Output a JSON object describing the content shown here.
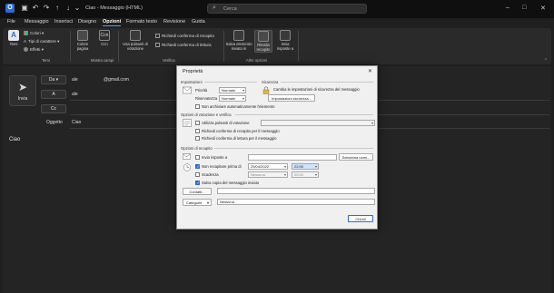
{
  "window": {
    "title": "Ciao - Messaggio (HTML)",
    "search_placeholder": "Cerca",
    "controls": {
      "minimize": "–",
      "maximize": "□",
      "close": "✕"
    },
    "quick_icons": [
      "save-icon",
      "undo-icon",
      "redo-icon",
      "up-icon",
      "down-icon",
      "customize-icon"
    ]
  },
  "menu": {
    "items": [
      "File",
      "Messaggio",
      "Inserisci",
      "Disegno",
      "Opzioni",
      "Formato testo",
      "Revisione",
      "Guida"
    ],
    "active": "Opzioni"
  },
  "ribbon": {
    "temi": {
      "big": "Temi",
      "colors": "Colori",
      "fonts": "Tipi di carattere",
      "effects": "Effetti",
      "group_label": "Temi"
    },
    "mostra": {
      "page_color": "Colore pagina",
      "cc": "Ccn",
      "group_label": "Mostra campi"
    },
    "tracking": {
      "voting": "Usa pulsanti di votazione",
      "delivery": "Richiedi conferma di recapito",
      "read": "Richiedi conferma di lettura",
      "group_label": "Verifica"
    },
    "altre": {
      "save_sent": "Salva elemento inviato in",
      "delay": "Ritarda recapito",
      "reply": "Invia risposte a",
      "group_label": "Altre opzioni"
    }
  },
  "compose": {
    "send": "Invia",
    "from_label": "Da",
    "from_value": "ale",
    "from_email": "@gmail.com",
    "to_label": "A",
    "to_value": "ale",
    "cc_label": "Cc",
    "subject_label": "Oggetto",
    "subject_value": "Ciao",
    "body": "Ciao"
  },
  "dialog": {
    "title": "Proprietà",
    "close": "✕",
    "settings": {
      "title": "Impostazioni",
      "priority_label": "Priorità",
      "priority_value": "Normale",
      "sensitivity_label": "Riservatezza",
      "sensitivity_value": "Normale",
      "no_autoarchive": "Non archiviare automaticamente l'elemento"
    },
    "security": {
      "title": "Sicurezza",
      "description": "Cambia le impostazioni di sicurezza del messaggio",
      "button": "Impostazioni sicurezza..."
    },
    "voting": {
      "title": "Opzioni di votazione e verifica",
      "use_voting": "Utilizza pulsanti di votazione",
      "request_delivery": "Richiedi conferma di recapito per il messaggio",
      "request_read": "Richiedi conferma di lettura per il messaggio"
    },
    "delivery": {
      "title": "Opzioni di recapito",
      "reply_to": "Invia risposte a",
      "select_names": "Seleziona nomi...",
      "no_deliver_before": "Non recapitare prima di",
      "date": "29/04/2022",
      "time": "22:00",
      "expires": "Scadenza",
      "exp_date": "Nessuna",
      "exp_time": "00:00",
      "save_copy": "Salva copia del messaggio inviato",
      "contacts": "Contatti...",
      "categories": "Categorie",
      "categories_value": "Nessuna"
    },
    "close_button": "Chiudi"
  }
}
